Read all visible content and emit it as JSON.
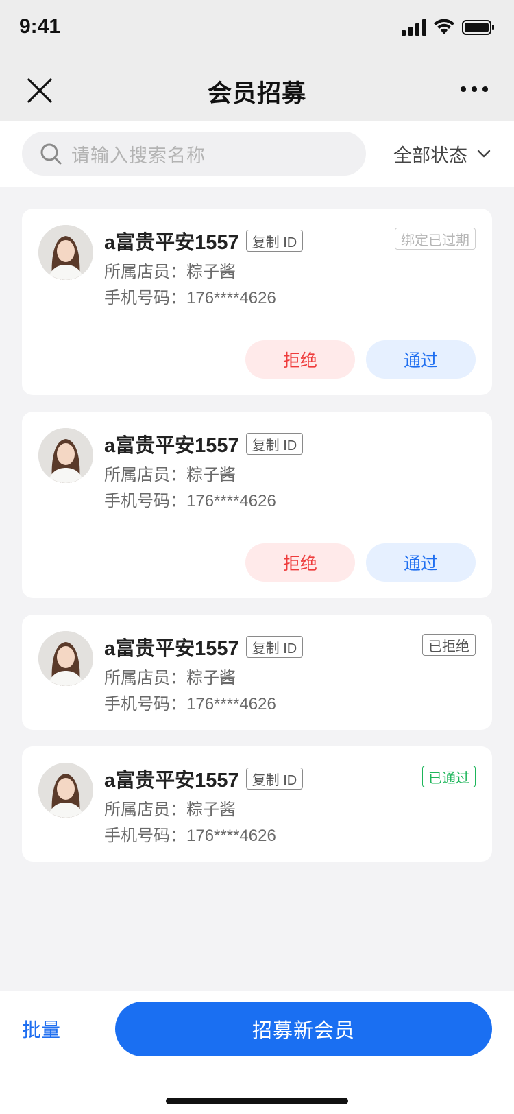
{
  "status_bar": {
    "time": "9:41"
  },
  "nav": {
    "title": "会员招募"
  },
  "search": {
    "placeholder": "请输入搜索名称",
    "filter_label": "全部状态"
  },
  "members": [
    {
      "name": "a富贵平安1557",
      "copy_label": "复制 ID",
      "staff_label": "所属店员：",
      "staff": "粽子酱",
      "phone_label": "手机号码：",
      "phone": "176****4626",
      "status": "绑定已过期",
      "reject_label": "拒绝",
      "approve_label": "通过"
    },
    {
      "name": "a富贵平安1557",
      "copy_label": "复制 ID",
      "staff_label": "所属店员：",
      "staff": "粽子酱",
      "phone_label": "手机号码：",
      "phone": "176****4626",
      "reject_label": "拒绝",
      "approve_label": "通过"
    },
    {
      "name": "a富贵平安1557",
      "copy_label": "复制 ID",
      "staff_label": "所属店员：",
      "staff": "粽子酱",
      "phone_label": "手机号码：",
      "phone": "176****4626",
      "status": "已拒绝"
    },
    {
      "name": "a富贵平安1557",
      "copy_label": "复制 ID",
      "staff_label": "所属店员：",
      "staff": "粽子酱",
      "phone_label": "手机号码：",
      "phone": "176****4626",
      "status": "已通过"
    }
  ],
  "bottom": {
    "batch_label": "批量",
    "recruit_label": "招募新会员"
  },
  "colors": {
    "primary": "#1a6ff2",
    "reject": "#ee3b3b",
    "approved": "#1db55a"
  }
}
